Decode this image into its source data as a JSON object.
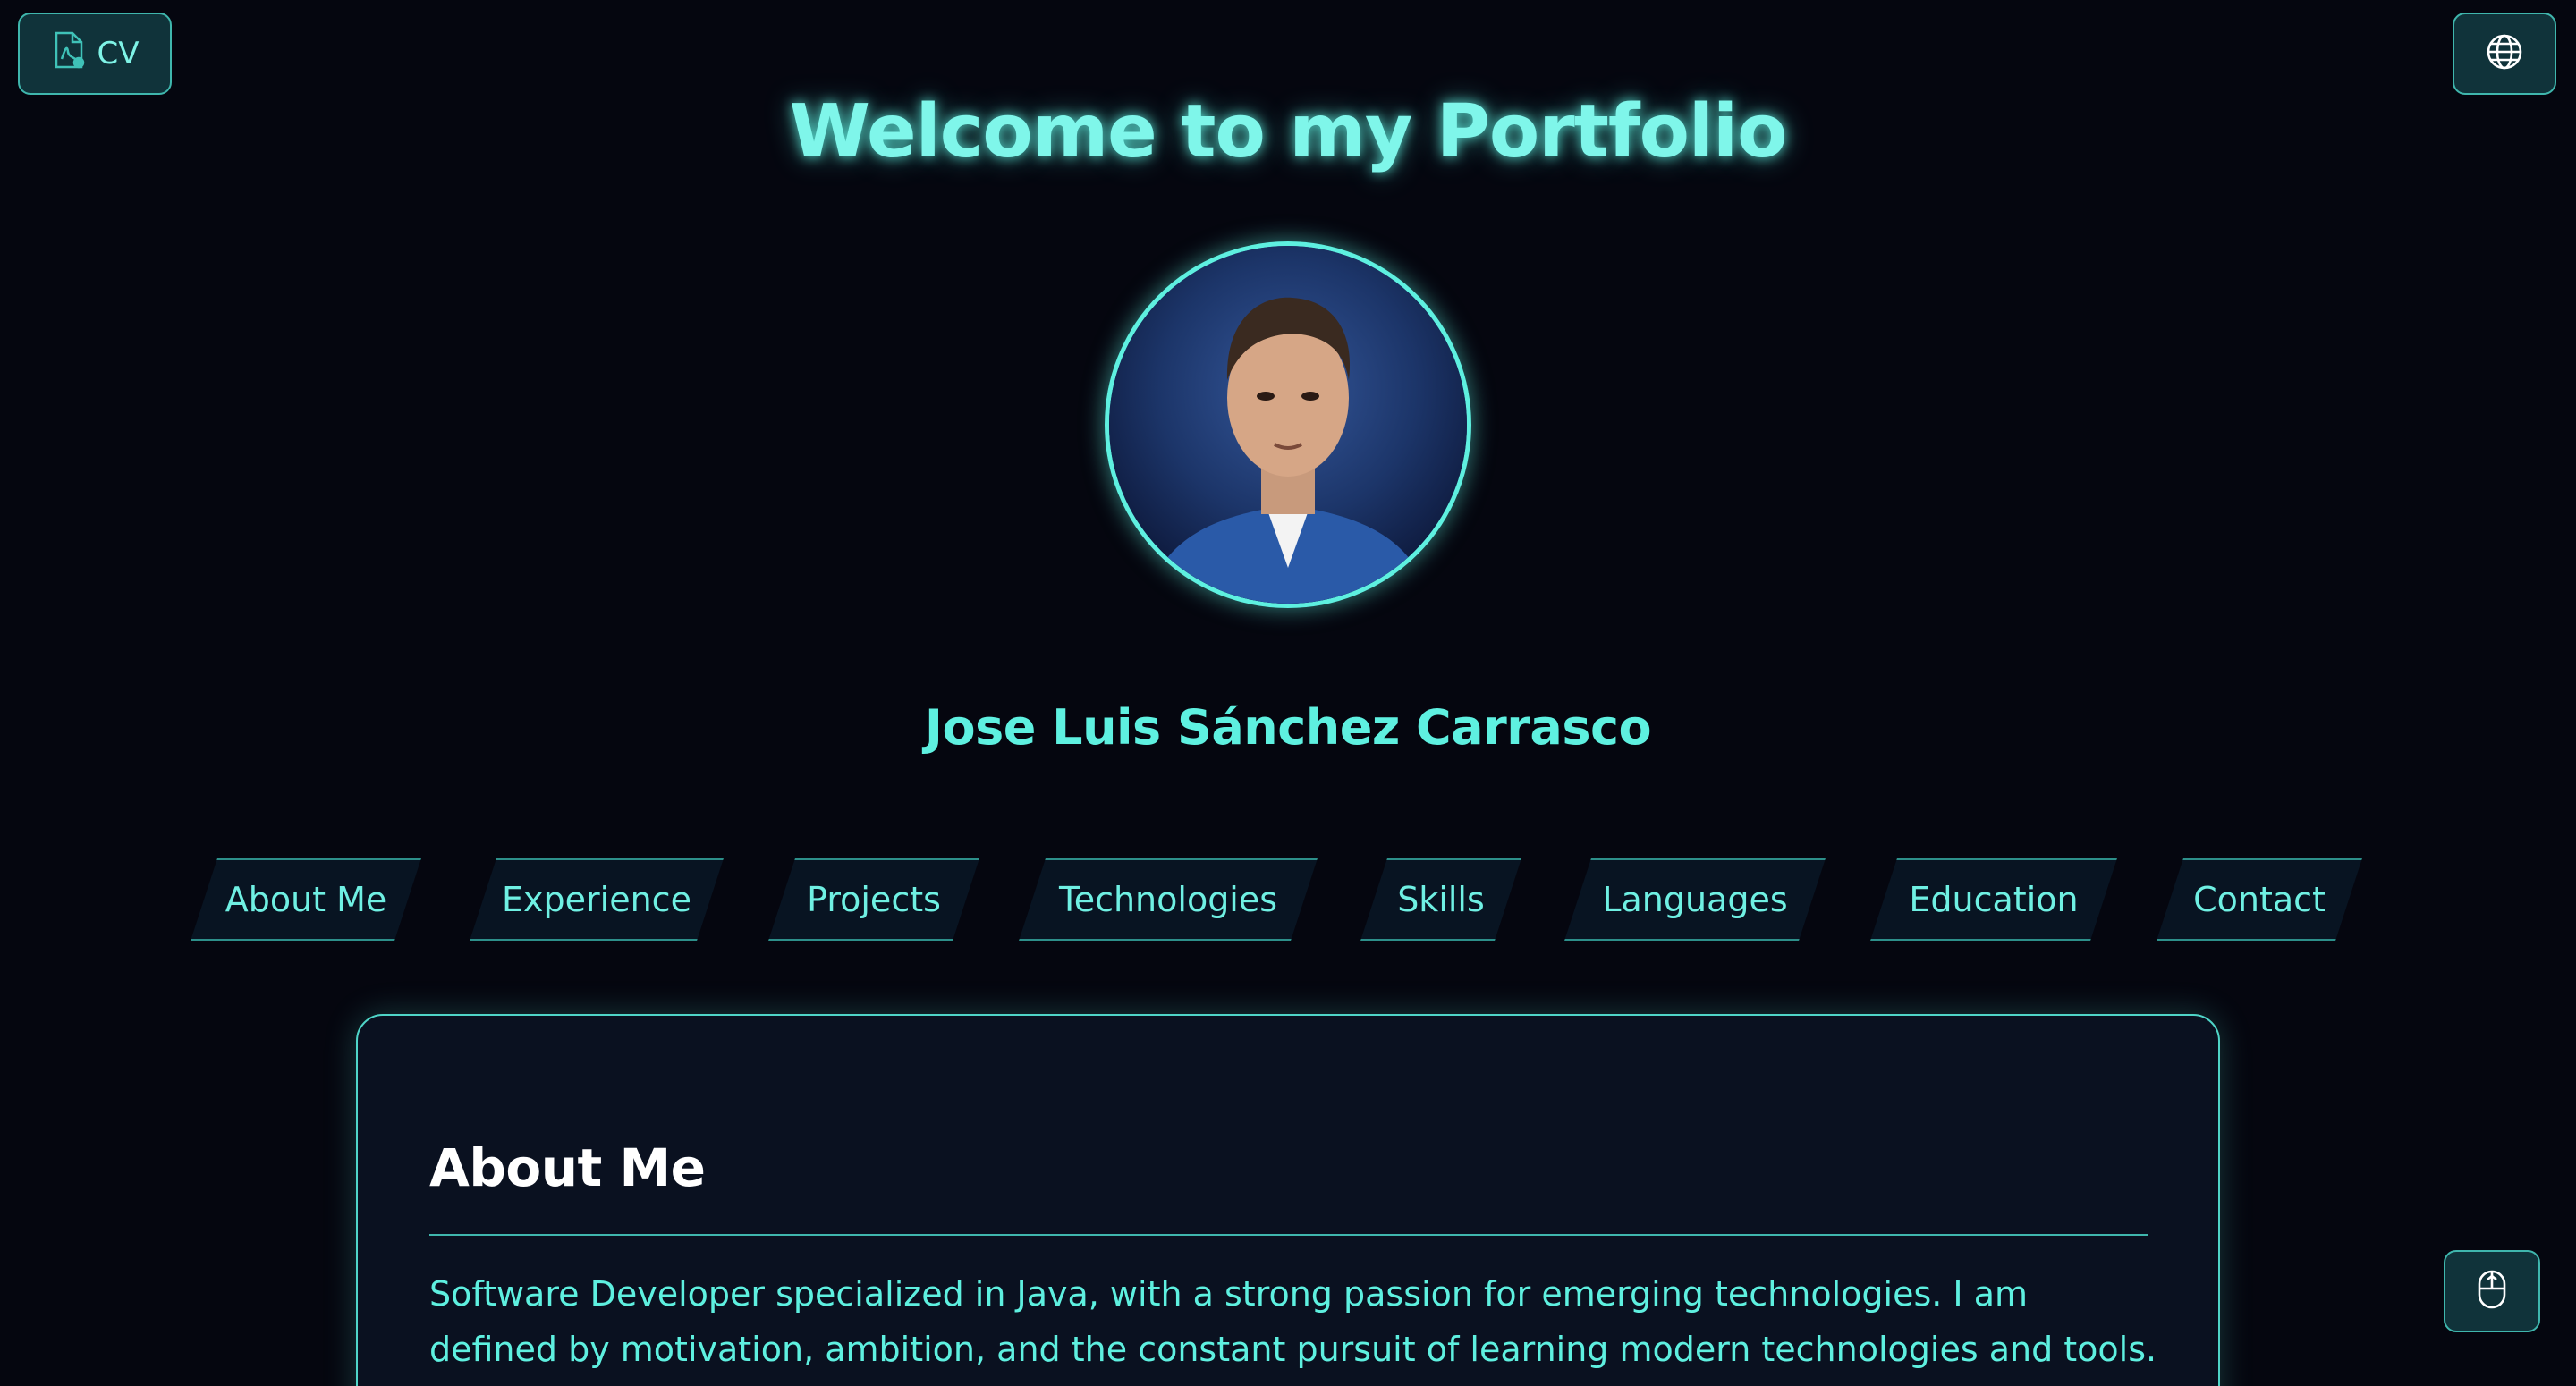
{
  "top_bar": {
    "cv_label": "CV",
    "cv_icon": "pdf-file-icon",
    "language_icon": "globe-icon"
  },
  "hero": {
    "title": "Welcome to my Portfolio",
    "name": "Jose Luis Sánchez Carrasco"
  },
  "nav": {
    "items": [
      {
        "label": "About Me"
      },
      {
        "label": "Experience"
      },
      {
        "label": "Projects"
      },
      {
        "label": "Technologies"
      },
      {
        "label": "Skills"
      },
      {
        "label": "Languages"
      },
      {
        "label": "Education"
      },
      {
        "label": "Contact"
      }
    ]
  },
  "about": {
    "heading": "About Me",
    "text": "Software Developer specialized in Java, with a strong passion for emerging technologies. I am defined by motivation, ambition, and the constant pursuit of learning modern technologies and tools. Committed to"
  },
  "scroll_icon": "mouse-scroll-icon",
  "colors": {
    "background": "#05060f",
    "accent": "#5ef0e0",
    "card_background": "#0a1120"
  }
}
